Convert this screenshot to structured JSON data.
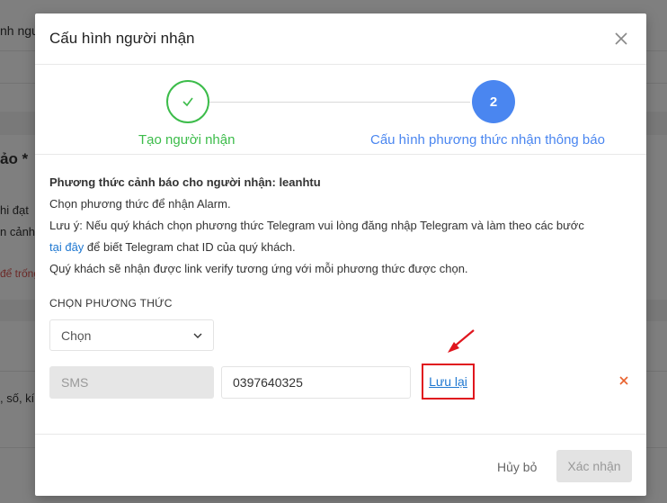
{
  "background": {
    "snippets": [
      {
        "text": "nh ngư"
      },
      {
        "text": "ảo *"
      },
      {
        "text": "hi đạt"
      },
      {
        "text": "n cảnh"
      },
      {
        "text": "để trống"
      },
      {
        "text": ", số, kí"
      }
    ]
  },
  "modal": {
    "title": "Cấu hình người nhận",
    "steps": [
      {
        "label": "Tạo người nhận",
        "status": "done"
      },
      {
        "number": "2",
        "label": "Cấu hình phương thức nhận thông báo",
        "status": "active"
      }
    ],
    "info": {
      "heading": "Phương thức cảnh báo cho người nhận: leanhtu",
      "line1": "Chọn phương thức để nhận Alarm.",
      "line2": "Lưu ý: Nếu quý khách chọn phương thức Telegram vui lòng đăng nhập Telegram và làm theo các bước",
      "link": "tại đây",
      "line3_rest": " để biết Telegram chat ID của quý khách.",
      "line4": "Quý khách sẽ nhận được link verify tương ứng với mỗi phương thức được chọn."
    },
    "method_section_label": "CHỌN PHƯƠNG THỨC",
    "method_select": {
      "value": "Chọn"
    },
    "method_row": {
      "method": "SMS",
      "phone_value": "0397640325",
      "save_label": "Lưu lại"
    },
    "footer": {
      "cancel_label": "Hủy bỏ",
      "confirm_label": "Xác nhận"
    }
  },
  "colors": {
    "success": "#3cbc4a",
    "primary": "#4a86f0",
    "link": "#1f78d1",
    "highlight": "#e0161e",
    "remove": "#e8612c"
  }
}
